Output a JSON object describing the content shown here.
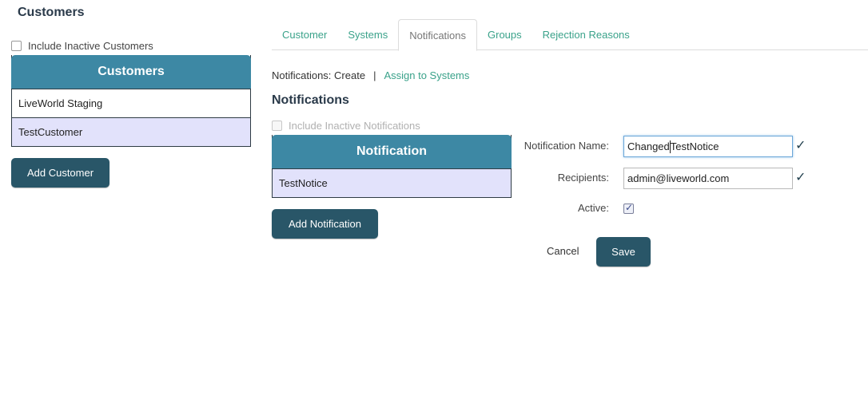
{
  "page": {
    "title": "Customers"
  },
  "customers": {
    "include_inactive_label": "Include Inactive Customers",
    "header": "Customers",
    "rows": [
      {
        "name": "LiveWorld Staging"
      },
      {
        "name": "TestCustomer"
      }
    ],
    "add_button": "Add Customer"
  },
  "tabs": [
    {
      "label": "Customer"
    },
    {
      "label": "Systems"
    },
    {
      "label": "Notifications"
    },
    {
      "label": "Groups"
    },
    {
      "label": "Rejection Reasons"
    }
  ],
  "breadcrumb": {
    "current": "Notifications: Create",
    "separator": "|",
    "link": "Assign to Systems"
  },
  "notifications": {
    "section_title": "Notifications",
    "include_inactive_label": "Include Inactive Notifications",
    "header": "Notification",
    "rows": [
      {
        "name": "TestNotice"
      }
    ],
    "add_button": "Add Notification"
  },
  "form": {
    "name_label": "Notification Name:",
    "name_value_before_caret": "Changed",
    "name_value_after_caret": "TestNotice",
    "recipients_label": "Recipients:",
    "recipients_value": "admin@liveworld.com",
    "active_label": "Active:",
    "active_checked": true,
    "cancel_label": "Cancel",
    "save_label": "Save"
  },
  "colors": {
    "header_teal": "#3d88a4",
    "button_dark": "#295668",
    "link_green": "#3aa28a",
    "selected_row": "#e2e2fb"
  },
  "icons": {
    "valid": "check-mark-icon"
  }
}
